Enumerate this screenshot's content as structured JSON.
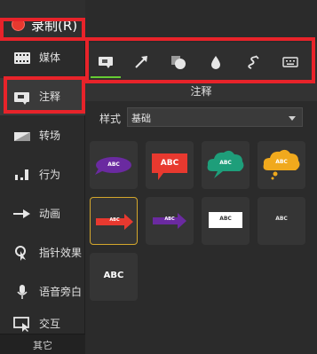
{
  "header": {
    "record_label": "录制(R)"
  },
  "sidebar": {
    "items": [
      {
        "label": "媒体",
        "icon": "film-icon"
      },
      {
        "label": "注释",
        "icon": "annotation-icon",
        "active": true
      },
      {
        "label": "转场",
        "icon": "transition-icon"
      },
      {
        "label": "行为",
        "icon": "behavior-icon"
      },
      {
        "label": "动画",
        "icon": "animation-icon"
      },
      {
        "label": "指针效果",
        "icon": "cursor-effect-icon"
      },
      {
        "label": "语音旁白",
        "icon": "microphone-icon"
      },
      {
        "label": "交互",
        "icon": "interactive-icon"
      }
    ],
    "footer_label": "其它"
  },
  "toolbar": {
    "tabs": [
      {
        "icon": "callout-icon",
        "active": true
      },
      {
        "icon": "arrow-icon"
      },
      {
        "icon": "shape-icon"
      },
      {
        "icon": "blur-drop-icon"
      },
      {
        "icon": "sketch-motion-icon"
      },
      {
        "icon": "keystroke-icon"
      }
    ]
  },
  "panel": {
    "title": "注释",
    "style_label": "样式",
    "style_value": "基础"
  },
  "tiles": [
    {
      "text": "ABC",
      "kind": "purple-speech"
    },
    {
      "text": "ABC",
      "kind": "red-speech"
    },
    {
      "text": "ABC",
      "kind": "green-cloud"
    },
    {
      "text": "ABC",
      "kind": "yellow-cloud"
    },
    {
      "text": "ABC",
      "kind": "red-arrow",
      "selected": true
    },
    {
      "text": "ABC",
      "kind": "purple-arrow"
    },
    {
      "text": "ABC",
      "kind": "white-box"
    },
    {
      "text": "ABC",
      "kind": "plain-text-dark"
    },
    {
      "text": "ABC",
      "kind": "plain-text-light"
    }
  ],
  "colors": {
    "record_red": "#e8392f",
    "active_tab": "#66cc33",
    "highlight": "#e8232a",
    "selection": "#d4a72c"
  }
}
